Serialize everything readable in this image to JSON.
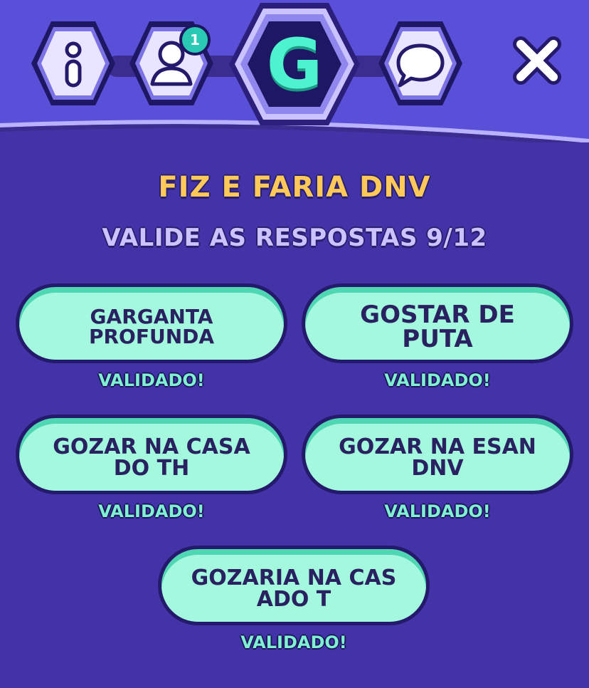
{
  "header": {
    "tabs": [
      {
        "name": "info",
        "icon": "info-icon"
      },
      {
        "name": "players",
        "icon": "user-icon",
        "badge": "1"
      },
      {
        "name": "game",
        "icon": "letter-g",
        "letter": "G"
      },
      {
        "name": "chat",
        "icon": "chat-bubble-icon"
      }
    ],
    "close_icon": "close-icon"
  },
  "main": {
    "category": "FIZ E FARIA DNV",
    "progress": "VALIDE AS RESPOSTAS 9/12"
  },
  "answers": [
    {
      "text": "GARGANTA PROFUNDA",
      "status": "VALIDADO!"
    },
    {
      "text": "GOSTAR DE PUTA",
      "status": "VALIDADO!"
    },
    {
      "text": "GOZAR NA CASA DO TH",
      "status": "VALIDADO!"
    },
    {
      "text": "GOZAR NA ESAN DNV",
      "status": "VALIDADO!"
    },
    {
      "text": "GOZARIA NA CAS ADO T",
      "status": "VALIDADO!"
    }
  ],
  "colors": {
    "background": "#4234a8",
    "header": "#5a4fd8",
    "accent_teal": "#4df2cf",
    "answer_fill": "#a3f8de",
    "category_text": "#ffc95a",
    "progress_text": "#c9c3ff",
    "status_text": "#7ff0d2"
  }
}
